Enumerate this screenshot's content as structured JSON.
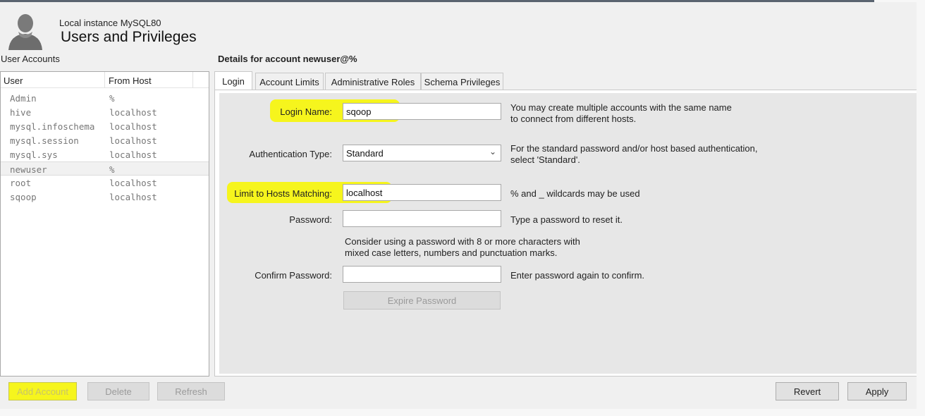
{
  "header": {
    "instance": "Local instance MySQL80",
    "title": "Users and Privileges",
    "avatar_icon": "user-silhouette-icon"
  },
  "user_accounts": {
    "label": "User Accounts",
    "columns": [
      "User",
      "From Host"
    ],
    "rows": [
      {
        "user": "Admin",
        "host": "%"
      },
      {
        "user": "hive",
        "host": "localhost"
      },
      {
        "user": "mysql.infoschema",
        "host": "localhost"
      },
      {
        "user": "mysql.session",
        "host": "localhost"
      },
      {
        "user": "mysql.sys",
        "host": "localhost"
      },
      {
        "user": "newuser",
        "host": "%"
      },
      {
        "user": "root",
        "host": "localhost"
      },
      {
        "user": "sqoop",
        "host": "localhost"
      }
    ],
    "selected_user": "newuser"
  },
  "details": {
    "title": "Details for account newuser@%",
    "tabs": [
      "Login",
      "Account Limits",
      "Administrative Roles",
      "Schema Privileges"
    ],
    "active_tab": "Login"
  },
  "login_form": {
    "login_name": {
      "label": "Login Name:",
      "value": "sqoop",
      "help": [
        "You may create multiple accounts with the same name",
        "to connect from different hosts."
      ]
    },
    "auth_type": {
      "label": "Authentication Type:",
      "value": "Standard",
      "help": [
        "For the standard password and/or host based authentication,",
        "select 'Standard'."
      ]
    },
    "hosts": {
      "label": "Limit to Hosts Matching:",
      "value": "localhost",
      "help": [
        "% and _ wildcards may be used"
      ]
    },
    "password": {
      "label": "Password:",
      "value": "",
      "help": [
        "Type a password to reset it."
      ]
    },
    "password_tip": [
      "Consider using a password with 8 or more characters with",
      "mixed case letters, numbers and punctuation marks."
    ],
    "confirm": {
      "label": "Confirm Password:",
      "value": "",
      "help": [
        "Enter password again to confirm."
      ]
    },
    "expire_button": "Expire Password"
  },
  "buttons": {
    "add_account": "Add Account",
    "delete": "Delete",
    "refresh": "Refresh",
    "revert": "Revert",
    "apply": "Apply"
  },
  "colors": {
    "highlight": "#f6f51d",
    "panel": "#e7e7e7"
  }
}
